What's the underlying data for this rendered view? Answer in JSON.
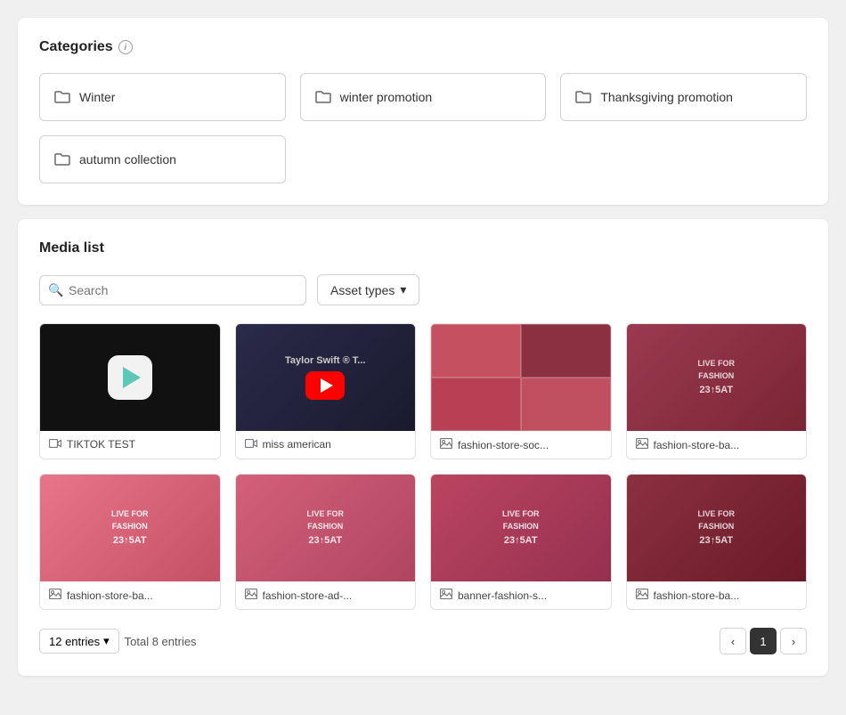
{
  "categories": {
    "title": "Categories",
    "info_icon": "i",
    "items": [
      {
        "id": "winter",
        "label": "Winter"
      },
      {
        "id": "winter-promotion",
        "label": "winter promotion"
      },
      {
        "id": "thanksgiving-promotion",
        "label": "Thanksgiving promotion"
      },
      {
        "id": "autumn-collection",
        "label": "autumn collection"
      }
    ]
  },
  "media_list": {
    "title": "Media list",
    "search_placeholder": "Search",
    "asset_types_label": "Asset types",
    "items": [
      {
        "id": "tiktok-test",
        "name": "TIKTOK TEST",
        "type": "video",
        "thumb_type": "black_play"
      },
      {
        "id": "miss-american",
        "name": "miss american",
        "type": "video",
        "thumb_type": "youtube"
      },
      {
        "id": "fashion-store-soc",
        "name": "fashion-store-soc...",
        "type": "image",
        "thumb_type": "fashion_grid"
      },
      {
        "id": "fashion-store-ba1",
        "name": "fashion-store-ba...",
        "type": "image",
        "thumb_type": "fashion_banner_dark"
      },
      {
        "id": "fashion-store-ba2",
        "name": "fashion-store-ba...",
        "type": "image",
        "thumb_type": "fashion_banner_light"
      },
      {
        "id": "fashion-store-ad",
        "name": "fashion-store-ad-...",
        "type": "image",
        "thumb_type": "fashion_banner_medium"
      },
      {
        "id": "banner-fashion-s",
        "name": "banner-fashion-s...",
        "type": "image",
        "thumb_type": "fashion_banner_medium2"
      },
      {
        "id": "fashion-store-ba3",
        "name": "fashion-store-ba...",
        "type": "image",
        "thumb_type": "fashion_banner_dark2"
      }
    ],
    "entries_label": "12 entries",
    "total_entries": "Total 8 entries",
    "current_page": 1,
    "chevron_down": "▾",
    "chevron_left": "‹",
    "chevron_right": "›"
  }
}
